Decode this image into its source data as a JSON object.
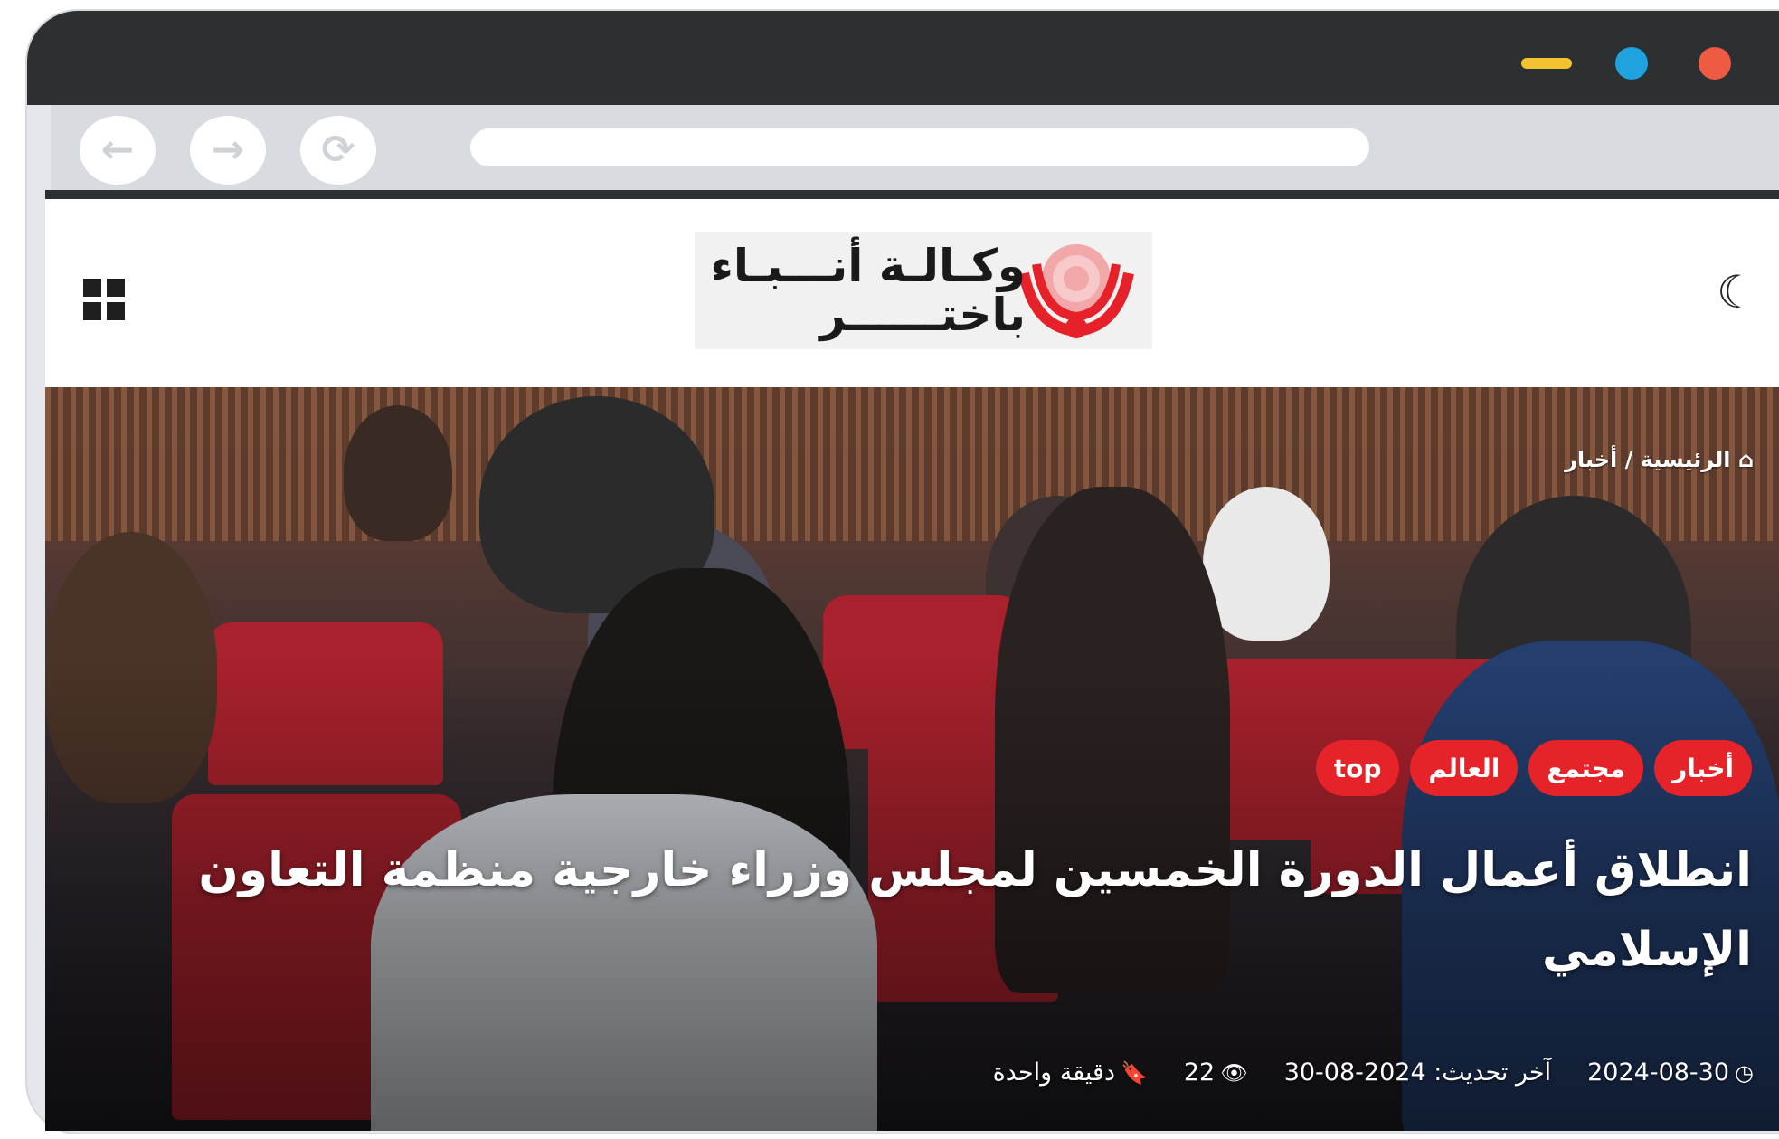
{
  "site": {
    "logo_line1": "وكـالـة أنـــبـاء",
    "logo_line2": "باختــــــر"
  },
  "icons": {
    "back": "arrow-left-icon",
    "forward": "arrow-right-icon",
    "reload": "reload-icon",
    "menu": "grid-icon",
    "theme": "moon-icon",
    "home": "home-icon",
    "date": "clock-icon",
    "views": "eye-icon",
    "read_time": "bookmark-icon"
  },
  "colors": {
    "accent": "#e62329",
    "logo_red": "#e6212a"
  },
  "article": {
    "breadcrumb": "الرئيسية / أخبار",
    "tags": [
      "أخبار",
      "مجتمع",
      "العالم",
      "top"
    ],
    "headline": "انطلاق أعمال الدورة الخمسين لمجلس وزراء خارجية منظمة التعاون الإسلامي",
    "date": "2024-08-30",
    "updated": "آخر تحديث: 2024-08-30",
    "views": "22",
    "read_time": "دقيقة واحدة"
  }
}
